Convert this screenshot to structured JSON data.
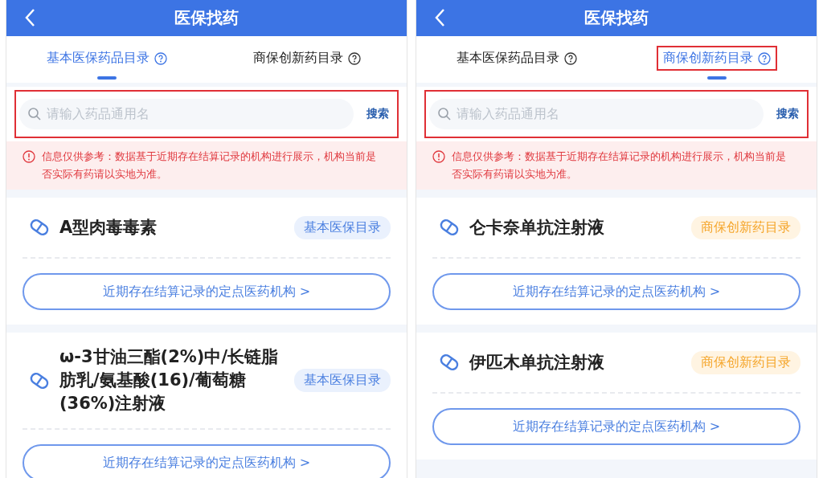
{
  "panels": [
    {
      "header": {
        "title": "医保找药"
      },
      "tabs": [
        {
          "label": "基本医保药品目录",
          "selected": true,
          "highlighted": false
        },
        {
          "label": "商保创新药目录",
          "selected": false,
          "highlighted": false
        }
      ],
      "search": {
        "placeholder": "请输入药品通用名",
        "button": "搜索",
        "highlighted": true
      },
      "notice": "信息仅供参考：数据基于近期存在结算记录的机构进行展示，机构当前是否实际有药请以实地为准。",
      "drugs": [
        {
          "name": "A型肉毒毒素",
          "tag": "基本医保目录",
          "kind": "basic",
          "link": "近期存在结算记录的定点医药机构 >"
        },
        {
          "name": "ω-3甘油三酯(2%)中/长链脂肪乳/氨基酸(16)/葡萄糖(36%)注射液",
          "tag": "基本医保目录",
          "kind": "basic",
          "link": "近期存在结算记录的定点医药机构 >"
        }
      ]
    },
    {
      "header": {
        "title": "医保找药"
      },
      "tabs": [
        {
          "label": "基本医保药品目录",
          "selected": false,
          "highlighted": false
        },
        {
          "label": "商保创新药目录",
          "selected": true,
          "highlighted": true
        }
      ],
      "search": {
        "placeholder": "请输入药品通用名",
        "button": "搜索",
        "highlighted": true
      },
      "notice": "信息仅供参考：数据基于近期存在结算记录的机构进行展示，机构当前是否实际有药请以实地为准。",
      "drugs": [
        {
          "name": "仑卡奈单抗注射液",
          "tag": "商保创新药目录",
          "kind": "commercial",
          "link": "近期存在结算记录的定点医药机构 >"
        },
        {
          "name": "伊匹木单抗注射液",
          "tag": "商保创新药目录",
          "kind": "commercial",
          "link": "近期存在结算记录的定点医药机构 >"
        }
      ]
    }
  ]
}
